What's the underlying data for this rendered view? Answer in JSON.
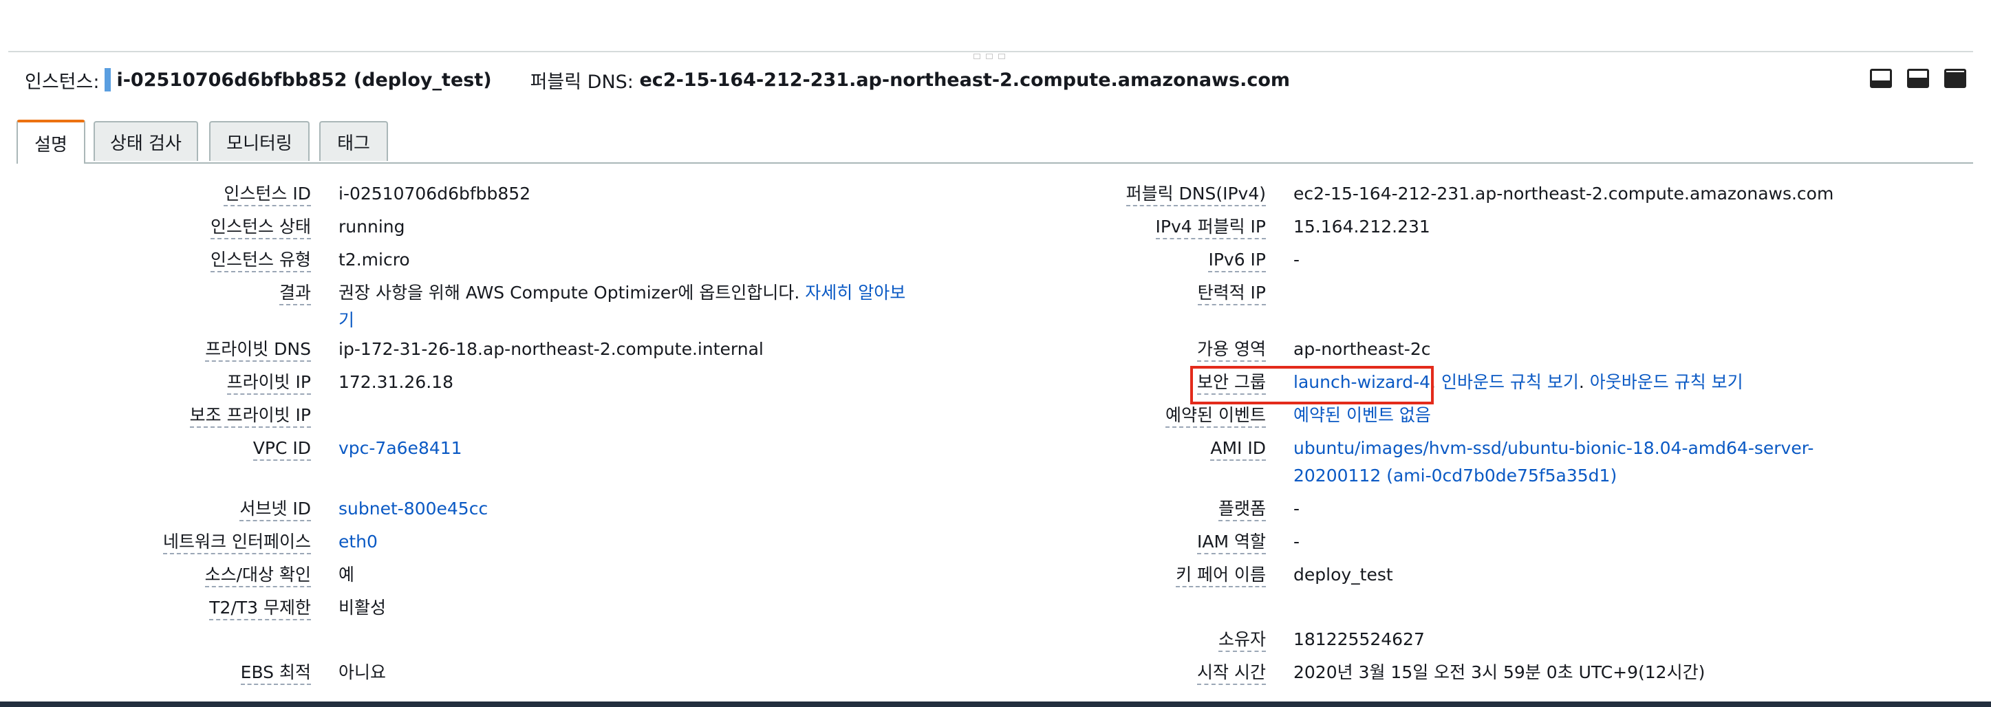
{
  "header": {
    "instance_label": "인스턴스:",
    "instance_value": "i-02510706d6bfbb852 (deploy_test)",
    "dns_label": "퍼블릭 DNS:",
    "dns_value": "ec2-15-164-212-231.ap-northeast-2.compute.amazonaws.com"
  },
  "tabs": [
    {
      "label": "설명"
    },
    {
      "label": "상태 검사"
    },
    {
      "label": "모니터링"
    },
    {
      "label": "태그"
    }
  ],
  "left": {
    "instance_id": {
      "k": "인스턴스 ID",
      "v": "i-02510706d6bfbb852"
    },
    "instance_state": {
      "k": "인스턴스 상태",
      "v": "running"
    },
    "instance_type": {
      "k": "인스턴스 유형",
      "v": "t2.micro"
    },
    "findings": {
      "k": "결과",
      "v": "권장 사항을 위해 AWS Compute Optimizer에 옵트인합니다.",
      "link1": "자세히 알아보",
      "link2": "기"
    },
    "private_dns": {
      "k": "프라이빗 DNS",
      "v": "ip-172-31-26-18.ap-northeast-2.compute.internal"
    },
    "private_ip": {
      "k": "프라이빗 IP",
      "v": "172.31.26.18"
    },
    "secondary_ip": {
      "k": "보조 프라이빗 IP",
      "v": ""
    },
    "vpc_id": {
      "k": "VPC ID",
      "v": "vpc-7a6e8411"
    },
    "subnet_id": {
      "k": "서브넷 ID",
      "v": "subnet-800e45cc"
    },
    "network_interface": {
      "k": "네트워크 인터페이스",
      "v": "eth0"
    },
    "source_dest_check": {
      "k": "소스/대상 확인",
      "v": "예"
    },
    "t2t3_unlimited": {
      "k": "T2/T3 무제한",
      "v": "비활성"
    },
    "ebs_optimized": {
      "k": "EBS 최적",
      "v": "아니요"
    }
  },
  "right": {
    "public_dns": {
      "k": "퍼블릭 DNS(IPv4)",
      "v": "ec2-15-164-212-231.ap-northeast-2.compute.amazonaws.com"
    },
    "ipv4_public_ip": {
      "k": "IPv4 퍼블릭 IP",
      "v": "15.164.212.231"
    },
    "ipv6_ip": {
      "k": "IPv6 IP",
      "v": "-"
    },
    "elastic_ip": {
      "k": "탄력적 IP",
      "v": ""
    },
    "availability_zone": {
      "k": "가용 영역",
      "v": "ap-northeast-2c"
    },
    "security_group": {
      "k": "보안 그룹",
      "link": "launch-wizard-4",
      "sep1": ". ",
      "inbound": "인바운드 규칙 보기",
      "sep2": ". ",
      "outbound": "아웃바운드 규칙 보기"
    },
    "scheduled_events": {
      "k": "예약된 이벤트",
      "link": "예약된 이벤트 없음"
    },
    "ami_id": {
      "k": "AMI ID",
      "line1": "ubuntu/images/hvm-ssd/ubuntu-bionic-18.04-amd64-server-",
      "line2": "20200112 (ami-0cd7b0de75f5a35d1)"
    },
    "platform": {
      "k": "플랫폼",
      "v": "-"
    },
    "iam_role": {
      "k": "IAM 역할",
      "v": "-"
    },
    "key_pair": {
      "k": "키 페어 이름",
      "v": "deploy_test"
    },
    "owner": {
      "k": "소유자",
      "v": "181225524627"
    },
    "launch_time": {
      "k": "시작 시간",
      "v": "2020년 3월 15일 오전 3시 59분 0초 UTC+9(12시간)"
    }
  },
  "colors": {
    "link": "#0a59c4",
    "tab_active_accent": "#ec7211",
    "highlight": "#e32b1b"
  },
  "icons": [
    "drag-handle-icon",
    "layout-bottom-small-icon",
    "layout-bottom-medium-icon",
    "layout-bottom-large-icon"
  ]
}
